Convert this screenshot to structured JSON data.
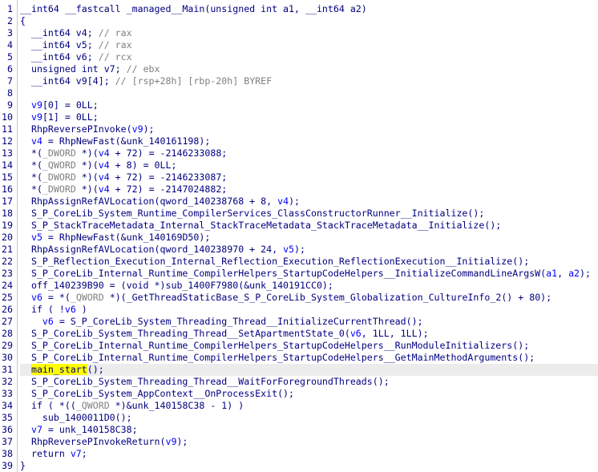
{
  "colors": {
    "code": "#000080",
    "comment": "#808080",
    "variable": "#0000ff",
    "selection": "#ffff00",
    "current_line": "#ececec"
  },
  "highlighted_line": 31,
  "lines": [
    {
      "n": "1",
      "tokens": [
        {
          "t": "__int64 __fastcall _managed__Main(unsigned int a1, __int64 a2)",
          "k": "code"
        }
      ]
    },
    {
      "n": "2",
      "tokens": [
        {
          "t": "{",
          "k": "code"
        }
      ]
    },
    {
      "n": "3",
      "tokens": [
        {
          "t": "  __int64 v4; ",
          "k": "code"
        },
        {
          "t": "// rax",
          "k": "cmt"
        }
      ]
    },
    {
      "n": "4",
      "tokens": [
        {
          "t": "  __int64 v5; ",
          "k": "code"
        },
        {
          "t": "// rax",
          "k": "cmt"
        }
      ]
    },
    {
      "n": "5",
      "tokens": [
        {
          "t": "  __int64 v6; ",
          "k": "code"
        },
        {
          "t": "// rcx",
          "k": "cmt"
        }
      ]
    },
    {
      "n": "6",
      "tokens": [
        {
          "t": "  unsigned int v7; ",
          "k": "code"
        },
        {
          "t": "// ebx",
          "k": "cmt"
        }
      ]
    },
    {
      "n": "7",
      "tokens": [
        {
          "t": "  __int64 v9[4]; ",
          "k": "code"
        },
        {
          "t": "// [rsp+28h] [rbp-20h] BYREF",
          "k": "cmt"
        }
      ]
    },
    {
      "n": "8",
      "tokens": [
        {
          "t": "",
          "k": "code"
        }
      ]
    },
    {
      "n": "9",
      "tokens": [
        {
          "t": "  ",
          "k": "code"
        },
        {
          "t": "v9",
          "k": "var"
        },
        {
          "t": "[0] = 0LL;",
          "k": "code"
        }
      ]
    },
    {
      "n": "10",
      "tokens": [
        {
          "t": "  ",
          "k": "code"
        },
        {
          "t": "v9",
          "k": "var"
        },
        {
          "t": "[1] = 0LL;",
          "k": "code"
        }
      ]
    },
    {
      "n": "11",
      "tokens": [
        {
          "t": "  RhpReversePInvoke(",
          "k": "code"
        },
        {
          "t": "v9",
          "k": "var"
        },
        {
          "t": ");",
          "k": "code"
        }
      ]
    },
    {
      "n": "12",
      "tokens": [
        {
          "t": "  ",
          "k": "code"
        },
        {
          "t": "v4",
          "k": "var"
        },
        {
          "t": " = RhpNewFast(&unk_140161198);",
          "k": "code"
        }
      ]
    },
    {
      "n": "13",
      "tokens": [
        {
          "t": "  *(",
          "k": "code"
        },
        {
          "t": "_DWORD",
          "k": "cmt"
        },
        {
          "t": " *)(",
          "k": "code"
        },
        {
          "t": "v4",
          "k": "var"
        },
        {
          "t": " + 72) = -2146233088;",
          "k": "code"
        }
      ]
    },
    {
      "n": "14",
      "tokens": [
        {
          "t": "  *(",
          "k": "code"
        },
        {
          "t": "_QWORD",
          "k": "cmt"
        },
        {
          "t": " *)(",
          "k": "code"
        },
        {
          "t": "v4",
          "k": "var"
        },
        {
          "t": " + 8) = 0LL;",
          "k": "code"
        }
      ]
    },
    {
      "n": "15",
      "tokens": [
        {
          "t": "  *(",
          "k": "code"
        },
        {
          "t": "_DWORD",
          "k": "cmt"
        },
        {
          "t": " *)(",
          "k": "code"
        },
        {
          "t": "v4",
          "k": "var"
        },
        {
          "t": " + 72) = -2146233087;",
          "k": "code"
        }
      ]
    },
    {
      "n": "16",
      "tokens": [
        {
          "t": "  *(",
          "k": "code"
        },
        {
          "t": "_DWORD",
          "k": "cmt"
        },
        {
          "t": " *)(",
          "k": "code"
        },
        {
          "t": "v4",
          "k": "var"
        },
        {
          "t": " + 72) = -2147024882;",
          "k": "code"
        }
      ]
    },
    {
      "n": "17",
      "tokens": [
        {
          "t": "  RhpAssignRefAVLocation(qword_140238768 + 8, ",
          "k": "code"
        },
        {
          "t": "v4",
          "k": "var"
        },
        {
          "t": ");",
          "k": "code"
        }
      ]
    },
    {
      "n": "18",
      "tokens": [
        {
          "t": "  S_P_CoreLib_System_Runtime_CompilerServices_ClassConstructorRunner__Initialize();",
          "k": "code"
        }
      ]
    },
    {
      "n": "19",
      "tokens": [
        {
          "t": "  S_P_StackTraceMetadata_Internal_StackTraceMetadata_StackTraceMetadata__Initialize();",
          "k": "code"
        }
      ]
    },
    {
      "n": "20",
      "tokens": [
        {
          "t": "  ",
          "k": "code"
        },
        {
          "t": "v5",
          "k": "var"
        },
        {
          "t": " = RhpNewFast(&unk_140169D50);",
          "k": "code"
        }
      ]
    },
    {
      "n": "21",
      "tokens": [
        {
          "t": "  RhpAssignRefAVLocation(qword_140238970 + 24, ",
          "k": "code"
        },
        {
          "t": "v5",
          "k": "var"
        },
        {
          "t": ");",
          "k": "code"
        }
      ]
    },
    {
      "n": "22",
      "tokens": [
        {
          "t": "  S_P_Reflection_Execution_Internal_Reflection_Execution_ReflectionExecution__Initialize();",
          "k": "code"
        }
      ]
    },
    {
      "n": "23",
      "tokens": [
        {
          "t": "  S_P_CoreLib_Internal_Runtime_CompilerHelpers_StartupCodeHelpers__InitializeCommandLineArgsW(",
          "k": "code"
        },
        {
          "t": "a1",
          "k": "var"
        },
        {
          "t": ", ",
          "k": "code"
        },
        {
          "t": "a2",
          "k": "var"
        },
        {
          "t": ");",
          "k": "code"
        }
      ]
    },
    {
      "n": "24",
      "tokens": [
        {
          "t": "  off_140239B90 = (void *)sub_1400F7980(&unk_140191CC0);",
          "k": "code"
        }
      ]
    },
    {
      "n": "25",
      "tokens": [
        {
          "t": "  ",
          "k": "code"
        },
        {
          "t": "v6",
          "k": "var"
        },
        {
          "t": " = *(",
          "k": "code"
        },
        {
          "t": "_QWORD",
          "k": "cmt"
        },
        {
          "t": " *)(_GetThreadStaticBase_S_P_CoreLib_System_Globalization_CultureInfo_2() + 80);",
          "k": "code"
        }
      ]
    },
    {
      "n": "26",
      "tokens": [
        {
          "t": "  if ( !",
          "k": "code"
        },
        {
          "t": "v6",
          "k": "var"
        },
        {
          "t": " )",
          "k": "code"
        }
      ]
    },
    {
      "n": "27",
      "tokens": [
        {
          "t": "    ",
          "k": "code"
        },
        {
          "t": "v6",
          "k": "var"
        },
        {
          "t": " = S_P_CoreLib_System_Threading_Thread__InitializeCurrentThread();",
          "k": "code"
        }
      ]
    },
    {
      "n": "28",
      "tokens": [
        {
          "t": "  S_P_CoreLib_System_Threading_Thread__SetApartmentState_0(",
          "k": "code"
        },
        {
          "t": "v6",
          "k": "var"
        },
        {
          "t": ", 1LL, 1LL);",
          "k": "code"
        }
      ]
    },
    {
      "n": "29",
      "tokens": [
        {
          "t": "  S_P_CoreLib_Internal_Runtime_CompilerHelpers_StartupCodeHelpers__RunModuleInitializers();",
          "k": "code"
        }
      ]
    },
    {
      "n": "30",
      "tokens": [
        {
          "t": "  S_P_CoreLib_Internal_Runtime_CompilerHelpers_StartupCodeHelpers__GetMainMethodArguments();",
          "k": "code"
        }
      ]
    },
    {
      "n": "31",
      "tokens": [
        {
          "t": "  ",
          "k": "code"
        },
        {
          "t": "main_start",
          "k": "sel"
        },
        {
          "t": "();",
          "k": "code"
        }
      ]
    },
    {
      "n": "32",
      "tokens": [
        {
          "t": "  S_P_CoreLib_System_Threading_Thread__WaitForForegroundThreads();",
          "k": "code"
        }
      ]
    },
    {
      "n": "33",
      "tokens": [
        {
          "t": "  S_P_CoreLib_System_AppContext__OnProcessExit();",
          "k": "code"
        }
      ]
    },
    {
      "n": "34",
      "tokens": [
        {
          "t": "  if ( *((",
          "k": "code"
        },
        {
          "t": "_QWORD",
          "k": "cmt"
        },
        {
          "t": " *)&unk_140158C38 - 1) )",
          "k": "code"
        }
      ]
    },
    {
      "n": "35",
      "tokens": [
        {
          "t": "    sub_1400011D0();",
          "k": "code"
        }
      ]
    },
    {
      "n": "36",
      "tokens": [
        {
          "t": "  ",
          "k": "code"
        },
        {
          "t": "v7",
          "k": "var"
        },
        {
          "t": " = unk_140158C38;",
          "k": "code"
        }
      ]
    },
    {
      "n": "37",
      "tokens": [
        {
          "t": "  RhpReversePInvokeReturn(",
          "k": "code"
        },
        {
          "t": "v9",
          "k": "var"
        },
        {
          "t": ");",
          "k": "code"
        }
      ]
    },
    {
      "n": "38",
      "tokens": [
        {
          "t": "  return ",
          "k": "code"
        },
        {
          "t": "v7",
          "k": "var"
        },
        {
          "t": ";",
          "k": "code"
        }
      ]
    },
    {
      "n": "39",
      "tokens": [
        {
          "t": "}",
          "k": "code"
        }
      ]
    }
  ]
}
